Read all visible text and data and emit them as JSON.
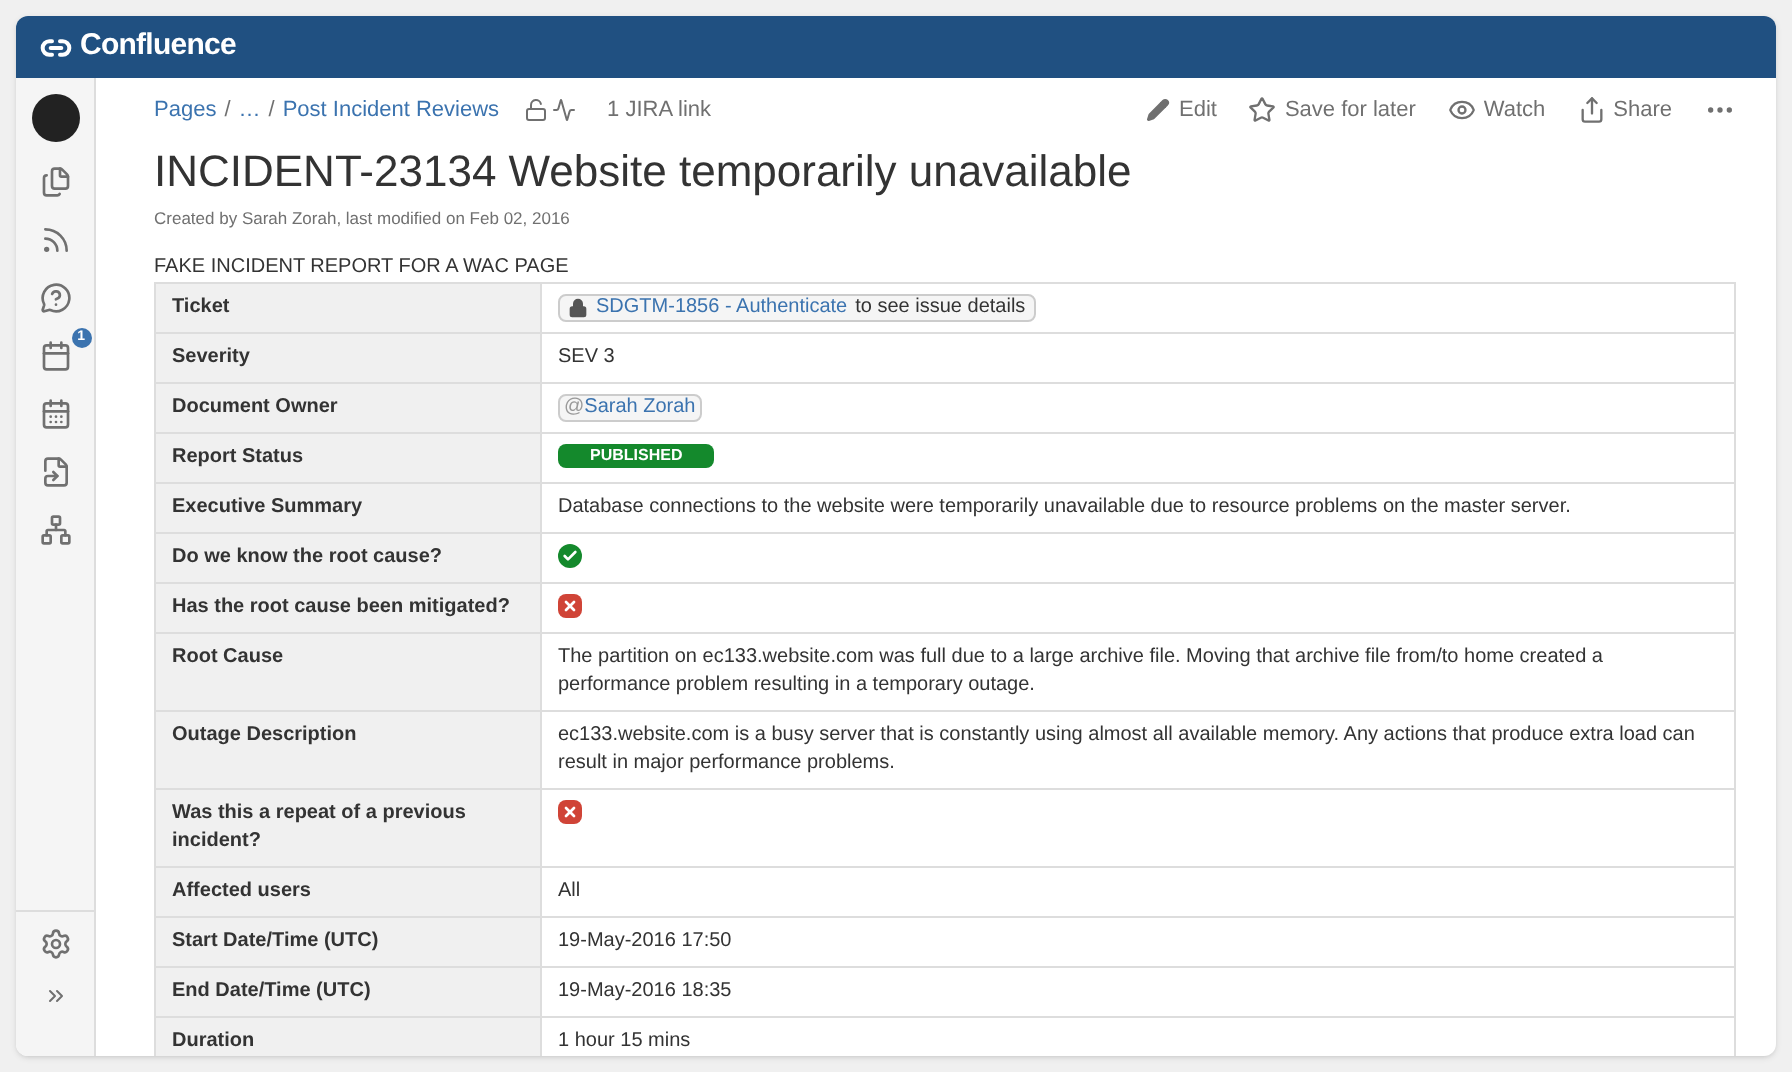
{
  "header": {
    "logo": "Confluence"
  },
  "sidebar": {
    "badge": "1"
  },
  "breadcrumbs": [
    {
      "label": "Pages"
    },
    {
      "separator": "/",
      "label": "…"
    },
    {
      "separator": "/",
      "label": "Post Incident Reviews"
    }
  ],
  "jira_links": "1 JIRA link",
  "actions": [
    {
      "kind": "edit",
      "label": "Edit"
    },
    {
      "kind": "save",
      "label": "Save for later"
    },
    {
      "kind": "watch",
      "label": "Watch"
    },
    {
      "kind": "share",
      "label": "Share"
    }
  ],
  "title": "INCIDENT-23134 Website temporarily unavailable",
  "byline": "Created by Sarah Zorah, last modified on Feb 02, 2016",
  "intro": "FAKE INCIDENT REPORT FOR A WAC PAGE",
  "table": {
    "rows": [
      {
        "label": "Ticket",
        "kind": "jira",
        "key": "SDGTM-1856 - Authenticate",
        "text": "to see issue details"
      },
      {
        "label": "Severity",
        "kind": "text",
        "text": "SEV 3"
      },
      {
        "label": "Document Owner",
        "kind": "mention",
        "at": "@",
        "text": "Sarah Zorah"
      },
      {
        "label": "Report Status",
        "kind": "status",
        "text": "PUBLISHED"
      },
      {
        "label": "Executive Summary",
        "kind": "text",
        "text": "Database connections to the website were temporarily unavailable due to resource problems on the master server."
      },
      {
        "label": "Do we know the root cause?",
        "kind": "answer",
        "positive": true
      },
      {
        "label": "Has the root cause been mitigated?",
        "kind": "answer",
        "positive": false
      },
      {
        "label": "Root Cause",
        "kind": "text",
        "text": "The partition on ec133.website.com was full due to a large archive file. Moving that archive file from/to home created a performance problem resulting in a temporary outage."
      },
      {
        "label": "Outage Description",
        "kind": "text",
        "text": "ec133.website.com is a busy server that is constantly using almost all available memory. Any actions that produce extra load can result in major performance problems."
      },
      {
        "label": "Was this a repeat of a previous incident?",
        "kind": "answer",
        "positive": false
      },
      {
        "label": "Affected users",
        "kind": "text",
        "text": "All"
      },
      {
        "label": "Start Date/Time (UTC)",
        "kind": "text",
        "text": "19-May-2016 17:50"
      },
      {
        "label": "End Date/Time (UTC)",
        "kind": "text",
        "text": "19-May-2016 18:35"
      },
      {
        "label": "Duration",
        "kind": "text",
        "text": "1 hour 15 mins"
      }
    ]
  }
}
